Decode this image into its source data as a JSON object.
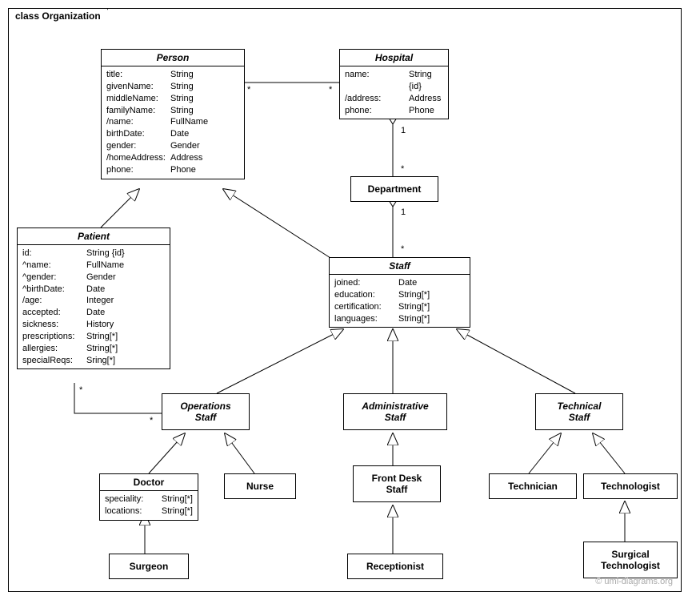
{
  "frame_label": "class Organization",
  "watermark": "© uml-diagrams.org",
  "classes": {
    "person": {
      "title": "Person",
      "attrs": [
        {
          "n": "title:",
          "t": "String"
        },
        {
          "n": "givenName:",
          "t": "String"
        },
        {
          "n": "middleName:",
          "t": "String"
        },
        {
          "n": "familyName:",
          "t": "String"
        },
        {
          "n": "/name:",
          "t": "FullName"
        },
        {
          "n": "birthDate:",
          "t": "Date"
        },
        {
          "n": "gender:",
          "t": "Gender"
        },
        {
          "n": "/homeAddress:",
          "t": "Address"
        },
        {
          "n": "phone:",
          "t": "Phone"
        }
      ]
    },
    "hospital": {
      "title": "Hospital",
      "attrs": [
        {
          "n": "name:",
          "t": "String {id}"
        },
        {
          "n": "/address:",
          "t": "Address"
        },
        {
          "n": "phone:",
          "t": "Phone"
        }
      ]
    },
    "patient": {
      "title": "Patient",
      "attrs": [
        {
          "n": "id:",
          "t": "String {id}"
        },
        {
          "n": "^name:",
          "t": "FullName"
        },
        {
          "n": "^gender:",
          "t": "Gender"
        },
        {
          "n": "^birthDate:",
          "t": "Date"
        },
        {
          "n": "/age:",
          "t": "Integer"
        },
        {
          "n": "accepted:",
          "t": "Date"
        },
        {
          "n": "sickness:",
          "t": "History"
        },
        {
          "n": "prescriptions:",
          "t": "String[*]"
        },
        {
          "n": "allergies:",
          "t": "String[*]"
        },
        {
          "n": "specialReqs:",
          "t": "Sring[*]"
        }
      ]
    },
    "staff": {
      "title": "Staff",
      "attrs": [
        {
          "n": "joined:",
          "t": "Date"
        },
        {
          "n": "education:",
          "t": "String[*]"
        },
        {
          "n": "certification:",
          "t": "String[*]"
        },
        {
          "n": "languages:",
          "t": "String[*]"
        }
      ]
    },
    "doctor": {
      "title": "Doctor",
      "attrs": [
        {
          "n": "speciality:",
          "t": "String[*]"
        },
        {
          "n": "locations:",
          "t": "String[*]"
        }
      ]
    },
    "department": {
      "title": "Department"
    },
    "operations_staff": {
      "title_l1": "Operations",
      "title_l2": "Staff"
    },
    "administrative_staff": {
      "title_l1": "Administrative",
      "title_l2": "Staff"
    },
    "technical_staff": {
      "title_l1": "Technical",
      "title_l2": "Staff"
    },
    "nurse": {
      "title": "Nurse"
    },
    "front_desk": {
      "title_l1": "Front Desk",
      "title_l2": "Staff"
    },
    "technician": {
      "title": "Technician"
    },
    "technologist": {
      "title": "Technologist"
    },
    "surgeon": {
      "title": "Surgeon"
    },
    "receptionist": {
      "title": "Receptionist"
    },
    "surgical_technologist": {
      "title_l1": "Surgical",
      "title_l2": "Technologist"
    }
  },
  "multiplicities": {
    "person_hospital_left": "*",
    "person_hospital_right": "*",
    "hospital_dept_top": "1",
    "hospital_dept_bot": "*",
    "dept_staff_top": "1",
    "dept_staff_bot": "*",
    "patient_ops_left": "*",
    "patient_ops_right": "*"
  }
}
